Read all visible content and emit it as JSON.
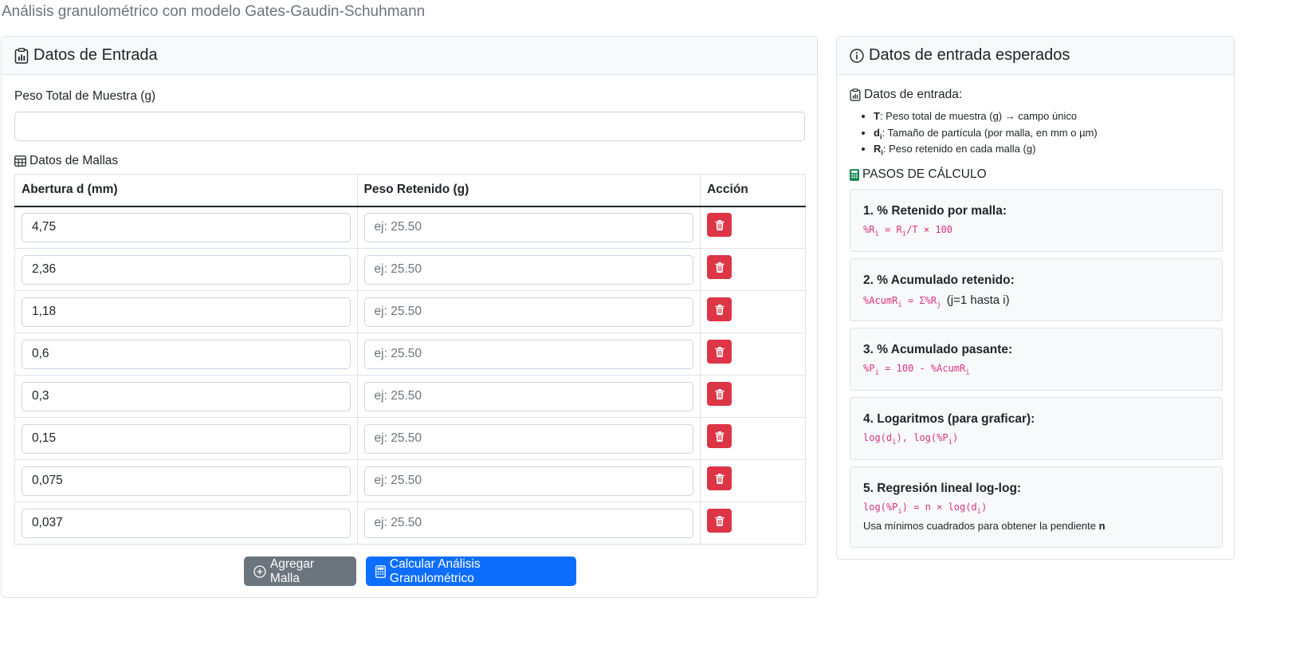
{
  "page": {
    "subtitle": "Análisis granulométrico con modelo Gates-Gaudin-Schuhmann"
  },
  "input_card": {
    "title": "Datos de Entrada",
    "total_label": "Peso Total de Muestra (g)",
    "total_value": "",
    "mallas_label": "Datos de Mallas",
    "columns": {
      "d": "Abertura d (mm)",
      "w": "Peso Retenido (g)",
      "a": "Acción"
    },
    "rows": [
      {
        "d": "4,75",
        "w_placeholder": "ej: 25.50"
      },
      {
        "d": "2,36",
        "w_placeholder": "ej: 25.50"
      },
      {
        "d": "1,18",
        "w_placeholder": "ej: 25.50"
      },
      {
        "d": "0,6",
        "w_placeholder": "ej: 25.50"
      },
      {
        "d": "0,3",
        "w_placeholder": "ej: 25.50"
      },
      {
        "d": "0,15",
        "w_placeholder": "ej: 25.50"
      },
      {
        "d": "0,075",
        "w_placeholder": "ej: 25.50"
      },
      {
        "d": "0,037",
        "w_placeholder": "ej: 25.50"
      }
    ],
    "add_button": "Agregar Malla",
    "calc_button": "Calcular Análisis Granulométrico"
  },
  "expected_card": {
    "title": "Datos de entrada esperados",
    "inputs_heading": "Datos de entrada:",
    "items": [
      {
        "sym": "T",
        "sub": "",
        "text": ": Peso total de muestra (g) → campo único"
      },
      {
        "sym": "d",
        "sub": "i",
        "text": ": Tamaño de partícula (por malla, en mm o µm)"
      },
      {
        "sym": "R",
        "sub": "i",
        "text": ": Peso retenido en cada malla (g)"
      }
    ],
    "steps_heading": "PASOS DE CÁLCULO",
    "steps": [
      {
        "title": "1. % Retenido por malla:"
      },
      {
        "title": "2. % Acumulado retenido:",
        "suffix": "(j=1 hasta i)"
      },
      {
        "title": "3. % Acumulado pasante:"
      },
      {
        "title": "4. Logaritmos (para graficar):"
      },
      {
        "title": "5. Regresión lineal log-log:",
        "note": "Usa mínimos cuadrados para obtener la pendiente ",
        "note_bold": "n"
      }
    ]
  },
  "colors": {
    "primary": "#0d6efd",
    "secondary": "#6c757d",
    "danger": "#dc3545",
    "formula": "#d63384",
    "success": "#198754"
  },
  "icons": [
    "clipboard-data-icon",
    "info-circle-icon",
    "table-icon",
    "trash-icon",
    "plus-circle-icon",
    "calculator-icon"
  ]
}
